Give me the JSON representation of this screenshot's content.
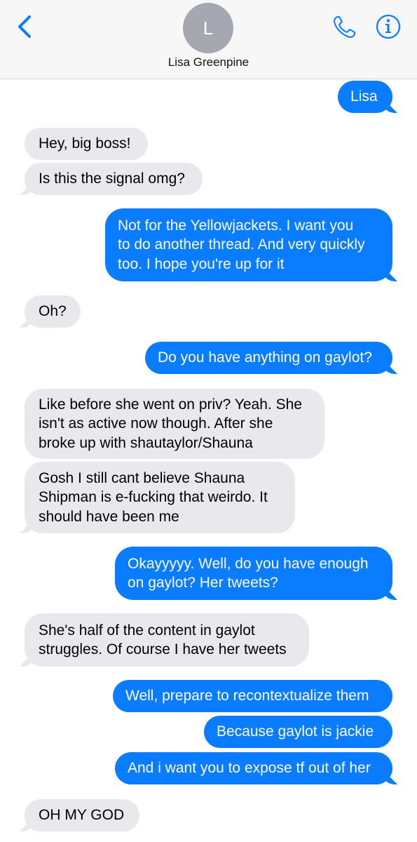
{
  "header": {
    "back_icon": "chevron-left-icon",
    "avatar_initial": "L",
    "contact_name": "Lisa Greenpine",
    "call_icon": "phone-icon",
    "info_icon": "info-icon",
    "accent_color": "#0a7cff"
  },
  "messages": [
    {
      "from": "me",
      "text": "Lisa"
    },
    {
      "from": "them",
      "text": "Hey, big boss!"
    },
    {
      "from": "them",
      "text": "Is this the signal omg?"
    },
    {
      "from": "me",
      "lines": [
        "Not for the Yellowjackets. I want you",
        "to do another thread. And very quickly",
        "too. I hope you're up for it"
      ]
    },
    {
      "from": "them",
      "text": "Oh?"
    },
    {
      "from": "me",
      "text": "Do you have anything on gaylot?"
    },
    {
      "from": "them",
      "lines": [
        "Like before she went on priv? Yeah. She",
        "isn't as active now though. After she",
        "broke up with shautaylor/Shauna"
      ]
    },
    {
      "from": "them",
      "lines": [
        "Gosh I still cant believe Shauna",
        "Shipman is e-fucking that weirdo. It",
        "should have been me"
      ]
    },
    {
      "from": "me",
      "lines": [
        "Okayyyyy. Well, do you have enough",
        "on gaylot?  Her tweets?"
      ]
    },
    {
      "from": "them",
      "lines": [
        "She's half of the content in gaylot",
        "struggles. Of course I have her tweets"
      ]
    },
    {
      "from": "me",
      "text": "Well, prepare to recontextualize them"
    },
    {
      "from": "me",
      "text": "Because gaylot is jackie"
    },
    {
      "from": "me",
      "text": "And i want you to expose tf out of her"
    },
    {
      "from": "them",
      "text": "OH MY GOD"
    }
  ]
}
